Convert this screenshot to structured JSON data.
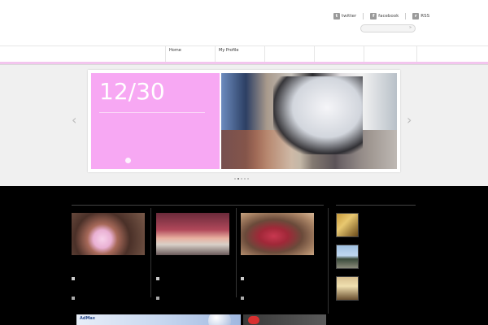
{
  "header": {
    "site_title": "",
    "social": [
      {
        "label": "twitter",
        "icon": "twitter-icon",
        "glyph": "t"
      },
      {
        "label": "facebook",
        "icon": "facebook-icon",
        "glyph": "f"
      },
      {
        "label": "RSS",
        "icon": "rss-icon",
        "glyph": "r"
      }
    ],
    "search": {
      "value": "",
      "button_glyph": "»"
    }
  },
  "nav": {
    "items": [
      "Home",
      "My Profile",
      "",
      "",
      ""
    ]
  },
  "slider": {
    "date": "12/30",
    "text": "",
    "more": "",
    "prev_glyph": "‹",
    "next_glyph": "›",
    "total": 5,
    "active": 1
  },
  "main": {
    "section_title": "",
    "cards": [
      {
        "title": "",
        "date": "",
        "excerpt": "",
        "more": ""
      },
      {
        "title": "",
        "date": "",
        "excerpt": "",
        "more": ""
      },
      {
        "title": "",
        "date": "",
        "excerpt": "",
        "more": ""
      }
    ]
  },
  "sidebar": {
    "section_title": "",
    "items": [
      {
        "date": "",
        "text": ""
      },
      {
        "date": "",
        "text": ""
      },
      {
        "date": "",
        "text": ""
      }
    ]
  },
  "ads": {
    "ad1": {
      "brand": "AdMax",
      "copy": ""
    },
    "ad2": {
      "copy": ""
    }
  },
  "colors": {
    "accent_pink": "#f7a8f3",
    "dark_background": "#000000",
    "slider_background": "#f0f0f0"
  }
}
